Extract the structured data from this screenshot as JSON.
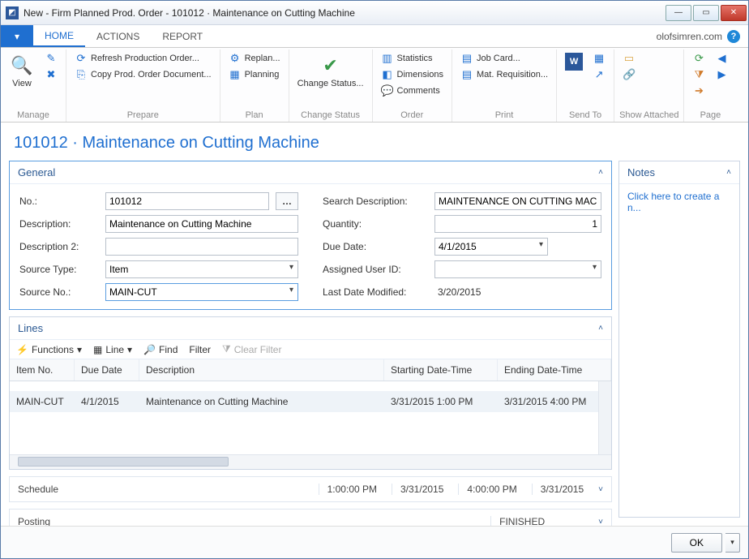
{
  "window": {
    "title": "New - Firm Planned Prod. Order - 101012 · Maintenance on Cutting Machine"
  },
  "tabs": {
    "file": "▾",
    "home": "HOME",
    "actions": "ACTIONS",
    "report": "REPORT"
  },
  "brand": {
    "text": "olofsimren.com"
  },
  "ribbon": {
    "manage": {
      "view": "View",
      "label": "Manage"
    },
    "prepare": {
      "refresh": "Refresh Production Order...",
      "copy": "Copy Prod. Order Document...",
      "label": "Prepare"
    },
    "plan": {
      "replan": "Replan...",
      "planning": "Planning",
      "label": "Plan"
    },
    "changestatus": {
      "btn": "Change Status...",
      "label": "Change Status"
    },
    "order": {
      "stats": "Statistics",
      "dims": "Dimensions",
      "comments": "Comments",
      "label": "Order"
    },
    "print": {
      "jobcard": "Job Card...",
      "matreq": "Mat. Requisition...",
      "label": "Print"
    },
    "sendto": {
      "label": "Send To"
    },
    "attached": {
      "label": "Show Attached"
    },
    "page": {
      "label": "Page"
    }
  },
  "header": {
    "title": "101012 · Maintenance on Cutting Machine"
  },
  "general": {
    "title": "General",
    "no_label": "No.:",
    "no": "101012",
    "desc_label": "Description:",
    "desc": "Maintenance on Cutting Machine",
    "desc2_label": "Description 2:",
    "desc2": "",
    "srctype_label": "Source Type:",
    "srctype": "Item",
    "srcno_label": "Source No.:",
    "srcno": "MAIN-CUT",
    "search_label": "Search Description:",
    "search": "MAINTENANCE ON CUTTING MACHINE",
    "qty_label": "Quantity:",
    "qty": "1",
    "due_label": "Due Date:",
    "due": "4/1/2015",
    "user_label": "Assigned User ID:",
    "user": "",
    "mod_label": "Last Date Modified:",
    "mod": "3/20/2015"
  },
  "lines": {
    "title": "Lines",
    "tb": {
      "functions": "Functions",
      "line": "Line",
      "find": "Find",
      "filter": "Filter",
      "clear": "Clear Filter"
    },
    "cols": {
      "item": "Item No.",
      "due": "Due Date",
      "desc": "Description",
      "start": "Starting Date-Time",
      "end": "Ending Date-Time"
    },
    "row": {
      "item": "MAIN-CUT",
      "due": "4/1/2015",
      "desc": "Maintenance on Cutting Machine",
      "start": "3/31/2015 1:00 PM",
      "end": "3/31/2015 4:00 PM"
    }
  },
  "schedule": {
    "label": "Schedule",
    "t1": "1:00:00 PM",
    "d1": "3/31/2015",
    "t2": "4:00:00 PM",
    "d2": "3/31/2015"
  },
  "posting": {
    "label": "Posting",
    "status": "FINISHED"
  },
  "notes": {
    "title": "Notes",
    "link": "Click here to create a n..."
  },
  "footer": {
    "ok": "OK"
  }
}
